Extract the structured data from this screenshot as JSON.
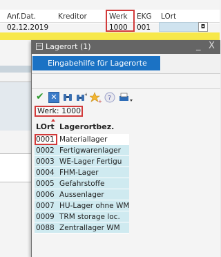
{
  "background": {
    "headers": {
      "anf_dat": "Anf.Dat.",
      "kreditor": "Kreditor",
      "werk": "Werk",
      "ekg": "EKG",
      "lort": "LOrt"
    },
    "row": {
      "anf_dat": "02.12.2019",
      "werk": "1000",
      "ekg": "001"
    }
  },
  "popup": {
    "title": "Lagerort (1)",
    "controls": {
      "minimize": "_",
      "close": "X"
    },
    "tab_label": "Eingabehilfe für Lagerorte",
    "werk_label": "Werk: 1000",
    "table": {
      "headers": [
        "LOrt",
        "Lagerortbez."
      ],
      "rows": [
        {
          "code": "0001",
          "name": "Materiallager"
        },
        {
          "code": "0002",
          "name": "Fertigwarenlager"
        },
        {
          "code": "0003",
          "name": "WE-Lager Fertigu"
        },
        {
          "code": "0004",
          "name": "FHM-Lager"
        },
        {
          "code": "0005",
          "name": "Gefahrstoffe"
        },
        {
          "code": "0006",
          "name": "Aussenlager"
        },
        {
          "code": "0007",
          "name": "HU-Lager ohne WM"
        },
        {
          "code": "0009",
          "name": "TRM storage loc."
        },
        {
          "code": "0088",
          "name": "Zentrallager WM"
        }
      ]
    }
  },
  "colors": {
    "accent": "#1b72c4",
    "highlight_border": "#d23a3a",
    "yellow_bar": "#f7e84a",
    "row_bg": "#cfeaf0"
  },
  "icons": [
    "continue-check-icon",
    "cancel-x-icon",
    "find-binoculars-icon",
    "find-next-icon",
    "favorites-star-icon",
    "help-icon",
    "print-icon"
  ]
}
